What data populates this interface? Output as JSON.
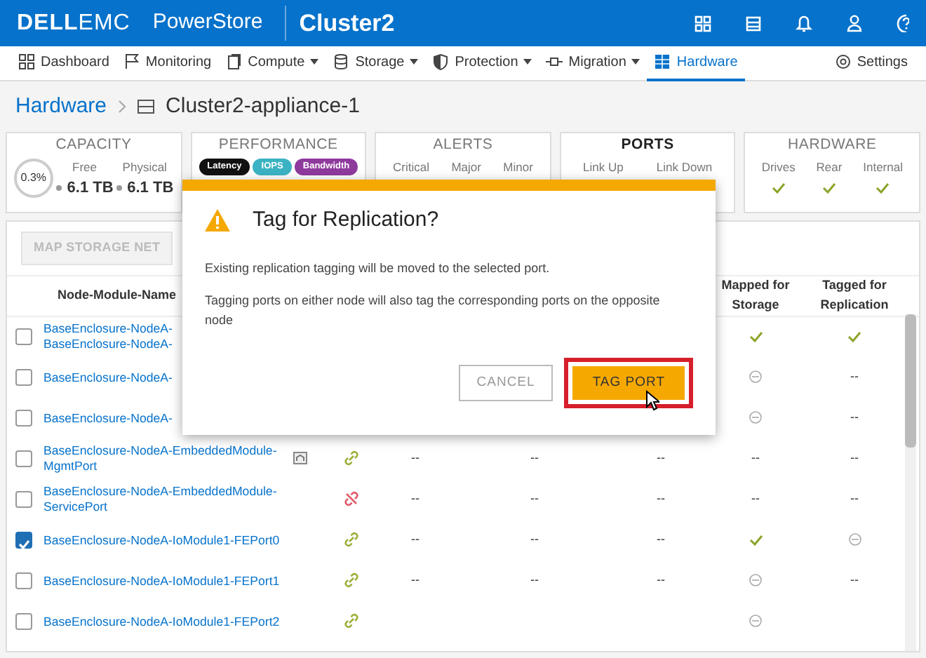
{
  "header": {
    "logo_dell": "DELL",
    "logo_emc": "EMC",
    "product": "PowerStore",
    "cluster": "Cluster2"
  },
  "nav": [
    {
      "label": "Dashboard",
      "dropdown": false,
      "selected": false
    },
    {
      "label": "Monitoring",
      "dropdown": false,
      "selected": false
    },
    {
      "label": "Compute",
      "dropdown": true,
      "selected": false
    },
    {
      "label": "Storage",
      "dropdown": true,
      "selected": false
    },
    {
      "label": "Protection",
      "dropdown": true,
      "selected": false
    },
    {
      "label": "Migration",
      "dropdown": true,
      "selected": false
    },
    {
      "label": "Hardware",
      "dropdown": false,
      "selected": true
    }
  ],
  "settings": "Settings",
  "breadcrumb": {
    "parent": "Hardware",
    "current": "Cluster2-appliance-1"
  },
  "summary": [
    {
      "kind": "capacity",
      "title": "CAPACITY",
      "selected": false,
      "percent": "0.3%",
      "labels": [
        "Free",
        "Physical"
      ],
      "values": [
        "6.1 TB",
        "6.1 TB"
      ]
    },
    {
      "kind": "badges",
      "title": "PERFORMANCE",
      "selected": false,
      "badges": [
        {
          "label": "Latency",
          "color": "#111111"
        },
        {
          "label": "IOPS",
          "color": "#3bb3c3"
        },
        {
          "label": "Bandwidth",
          "color": "#8e3a9d"
        }
      ]
    },
    {
      "kind": "labels",
      "title": "ALERTS",
      "selected": false,
      "labels": [
        "Critical",
        "Major",
        "Minor"
      ]
    },
    {
      "kind": "labels",
      "title": "PORTS",
      "selected": true,
      "labels": [
        "Link Up",
        "Link Down"
      ]
    },
    {
      "kind": "checks",
      "title": "HARDWARE",
      "selected": false,
      "labels": [
        "Drives",
        "Rear",
        "Internal"
      ]
    }
  ],
  "toolbar": {
    "button": "MAP STORAGE NET",
    "disabled": true
  },
  "table": {
    "columns": [
      "Node-Module-Name",
      "",
      "",
      "",
      "",
      "",
      "Mapped for Storage",
      "Tagged for Replication"
    ],
    "rows": [
      {
        "checked": false,
        "name": [
          "BaseEnclosure-NodeA-",
          "BaseEnclosure-NodeA-"
        ],
        "cells": [
          null,
          null,
          null,
          {
            "kind": "check"
          },
          {
            "kind": "check"
          }
        ]
      },
      {
        "checked": false,
        "name": [
          "BaseEnclosure-NodeA-"
        ],
        "cells": [
          null,
          null,
          null,
          {
            "kind": "minus"
          },
          {
            "kind": "text",
            "text": "--"
          }
        ]
      },
      {
        "checked": false,
        "name": [
          "BaseEnclosure-NodeA-"
        ],
        "cells": [
          null,
          null,
          null,
          {
            "kind": "minus"
          },
          {
            "kind": "text",
            "text": "--"
          }
        ]
      },
      {
        "checked": false,
        "name": [
          "BaseEnclosure-NodeA-EmbeddedModule-",
          "MgmtPort"
        ],
        "mgmt": true,
        "linked": true,
        "cells": [
          {
            "kind": "text",
            "text": "--"
          },
          {
            "kind": "text",
            "text": "--"
          },
          {
            "kind": "text",
            "text": "--"
          },
          {
            "kind": "text",
            "text": "--"
          },
          {
            "kind": "text",
            "text": "--"
          }
        ]
      },
      {
        "checked": false,
        "name": [
          "BaseEnclosure-NodeA-EmbeddedModule-",
          "ServicePort"
        ],
        "mgmt": false,
        "linked": false,
        "cells": [
          {
            "kind": "text",
            "text": "--"
          },
          {
            "kind": "text",
            "text": "--"
          },
          {
            "kind": "text",
            "text": "--"
          },
          {
            "kind": "text",
            "text": "--"
          },
          {
            "kind": "text",
            "text": "--"
          }
        ]
      },
      {
        "checked": true,
        "name": [
          "BaseEnclosure-NodeA-IoModule1-FEPort0"
        ],
        "mgmt": false,
        "linked": true,
        "cells": [
          {
            "kind": "text",
            "text": "--"
          },
          {
            "kind": "text",
            "text": "--"
          },
          {
            "kind": "text",
            "text": "--"
          },
          {
            "kind": "check"
          },
          {
            "kind": "minus"
          }
        ]
      },
      {
        "checked": false,
        "name": [
          "BaseEnclosure-NodeA-IoModule1-FEPort1"
        ],
        "mgmt": false,
        "linked": true,
        "cells": [
          {
            "kind": "text",
            "text": "--"
          },
          {
            "kind": "text",
            "text": "--"
          },
          {
            "kind": "text",
            "text": "--"
          },
          {
            "kind": "minus"
          },
          {
            "kind": "text",
            "text": "--"
          }
        ]
      },
      {
        "checked": false,
        "name": [
          "BaseEnclosure-NodeA-IoModule1-FEPort2"
        ],
        "mgmt": false,
        "linked": true,
        "cells": [
          null,
          null,
          null,
          {
            "kind": "minus"
          },
          null
        ]
      }
    ]
  },
  "dialog": {
    "title": "Tag for Replication?",
    "paragraphs": [
      "Existing replication tagging will be moved to the selected port.",
      "Tagging ports on either node will also tag the corresponding ports on the opposite node"
    ],
    "cancel": "CANCEL",
    "confirm": "TAG PORT",
    "highlighted": true
  }
}
